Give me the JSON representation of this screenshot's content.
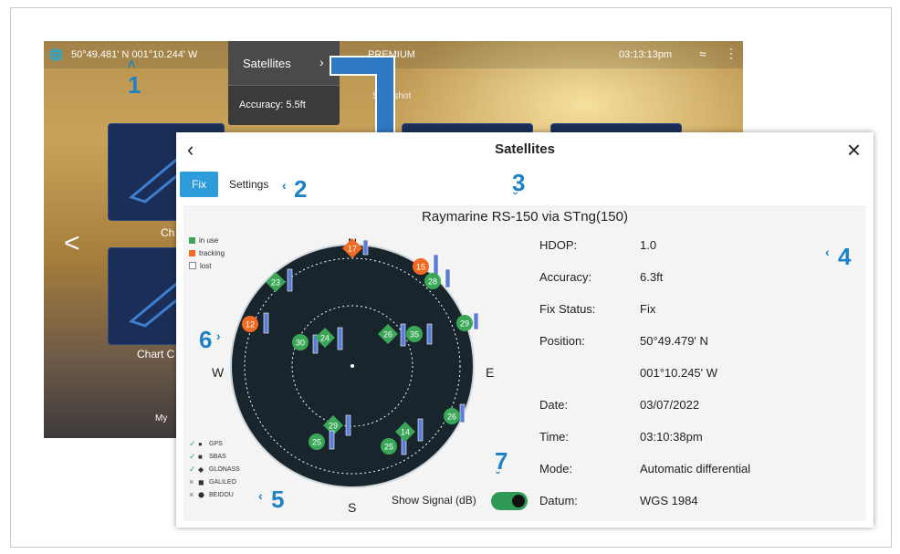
{
  "background": {
    "position_text": "50°49.481' N   001°10.244' W",
    "premium_label": "PREMIUM",
    "snapshot_label": "Snapshot",
    "time": "03:13:13pm",
    "tile_labels": [
      "Ch",
      "Chart C",
      "My"
    ]
  },
  "popover": {
    "satellites_label": "Satellites",
    "accuracy_label": "Accuracy: 5.5ft"
  },
  "dialog": {
    "title": "Satellites",
    "tabs": {
      "fix": "Fix",
      "settings": "Settings"
    },
    "source": "Raymarine RS-150 via STng(150)"
  },
  "legend_status": [
    {
      "label": "in use",
      "color": "#3aa757"
    },
    {
      "label": "tracking",
      "color": "#f26b22"
    },
    {
      "label": "lost",
      "color": "#ffffff"
    }
  ],
  "legend_constellations": [
    {
      "label": "GPS",
      "enabled": true,
      "marker": "circle"
    },
    {
      "label": "SBAS",
      "enabled": true,
      "marker": "square"
    },
    {
      "label": "GLONASS",
      "enabled": true,
      "marker": "diamond"
    },
    {
      "label": "GALILEO",
      "enabled": false,
      "marker": "rounded-square"
    },
    {
      "label": "BEIDOU",
      "enabled": false,
      "marker": "hexagon"
    }
  ],
  "compass": {
    "n": "N",
    "s": "S",
    "e": "E",
    "w": "W"
  },
  "satellites": [
    {
      "id": "17",
      "status": "tracking",
      "shape": "diamond"
    },
    {
      "id": "15",
      "status": "tracking",
      "shape": "circle"
    },
    {
      "id": "23",
      "status": "in use",
      "shape": "diamond"
    },
    {
      "id": "28",
      "status": "in use",
      "shape": "circle"
    },
    {
      "id": "29",
      "status": "in use",
      "shape": "circle"
    },
    {
      "id": "12",
      "status": "tracking",
      "shape": "circle"
    },
    {
      "id": "30",
      "status": "in use",
      "shape": "circle"
    },
    {
      "id": "24",
      "status": "in use",
      "shape": "diamond"
    },
    {
      "id": "26",
      "status": "in use",
      "shape": "diamond"
    },
    {
      "id": "35",
      "status": "in use",
      "shape": "circle"
    },
    {
      "id": "26",
      "status": "in use",
      "shape": "circle"
    },
    {
      "id": "29",
      "status": "in use",
      "shape": "diamond"
    },
    {
      "id": "25",
      "status": "in use",
      "shape": "circle"
    },
    {
      "id": "25",
      "status": "in use",
      "shape": "circle"
    },
    {
      "id": "14",
      "status": "in use",
      "shape": "diamond"
    }
  ],
  "toggle": {
    "label": "Show Signal (dB)",
    "on": true
  },
  "info": [
    {
      "label": "HDOP:",
      "value": "1.0"
    },
    {
      "label": "Accuracy:",
      "value": "6.3ft"
    },
    {
      "label": "Fix Status:",
      "value": "Fix"
    },
    {
      "label": "Position:",
      "value": "50°49.479' N"
    },
    {
      "label": "",
      "value": "001°10.245' W"
    },
    {
      "label": "Date:",
      "value": "03/07/2022"
    },
    {
      "label": "Time:",
      "value": "03:10:38pm"
    },
    {
      "label": "Mode:",
      "value": "Automatic differential"
    },
    {
      "label": "Datum:",
      "value": "WGS 1984"
    }
  ],
  "annotations": [
    "1",
    "2",
    "3",
    "4",
    "5",
    "6",
    "7"
  ],
  "colors": {
    "accent": "#2d9cdb",
    "annotation": "#1f82c6",
    "in_use": "#3aa757",
    "tracking": "#f26b22"
  }
}
